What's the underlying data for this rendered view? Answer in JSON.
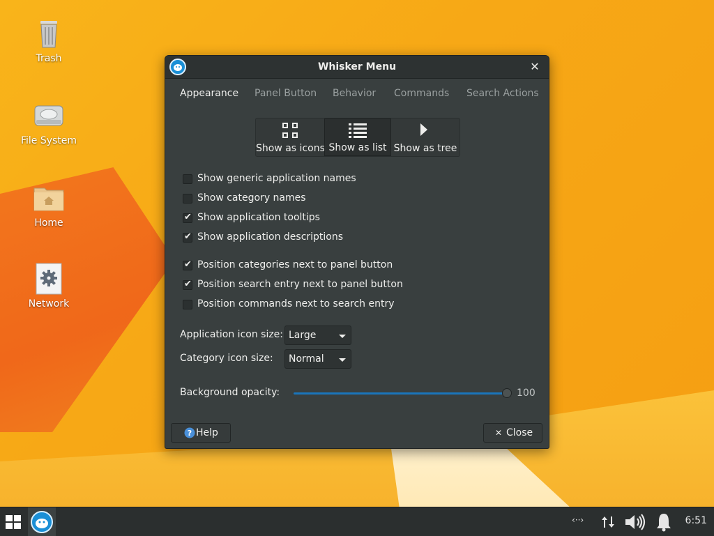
{
  "desktop": {
    "icons": [
      {
        "label": "Trash",
        "icon": "trash-icon"
      },
      {
        "label": "File System",
        "icon": "drive-icon"
      },
      {
        "label": "Home",
        "icon": "home-folder-icon"
      },
      {
        "label": "Network",
        "icon": "network-gear-icon"
      }
    ]
  },
  "dialog": {
    "title": "Whisker Menu",
    "tabs": [
      "Appearance",
      "Panel Button",
      "Behavior",
      "Commands",
      "Search Actions"
    ],
    "active_tab": "Appearance",
    "view_modes": [
      {
        "label": "Show as icons",
        "icon": "grid-icon"
      },
      {
        "label": "Show as list",
        "icon": "list-icon"
      },
      {
        "label": "Show as tree",
        "icon": "triangle-right-icon"
      }
    ],
    "active_view": "Show as list",
    "checkboxes_group1": [
      {
        "label": "Show generic application names",
        "checked": false
      },
      {
        "label": "Show category names",
        "checked": false
      },
      {
        "label": "Show application tooltips",
        "checked": true
      },
      {
        "label": "Show application descriptions",
        "checked": true
      }
    ],
    "checkboxes_group2": [
      {
        "label": "Position categories next to panel button",
        "checked": true
      },
      {
        "label": "Position search entry next to panel button",
        "checked": true
      },
      {
        "label": "Position commands next to search entry",
        "checked": false
      }
    ],
    "app_icon_size": {
      "label": "Application icon size:",
      "value": "Large"
    },
    "category_icon_size": {
      "label": "Category icon size:",
      "value": "Normal"
    },
    "opacity": {
      "label": "Background opacity:",
      "value": "100",
      "fraction": 1.0
    },
    "help_label": "Help",
    "close_label": "Close"
  },
  "taskbar": {
    "clock": "6:51",
    "network_glyph": "‹··›"
  },
  "colors": {
    "dialog_bg": "#393f3f",
    "accent": "#1a75bb",
    "taskbar_bg": "#2b2f2f"
  }
}
